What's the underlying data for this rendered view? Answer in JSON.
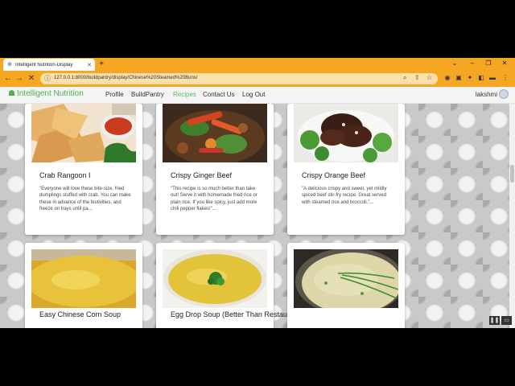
{
  "browser": {
    "tab_title": "Intelligent Nutrition-Display",
    "url": "127.0.0.1:8000/buildpantry/display/Chinese%20Steamed%20Buns/",
    "accent": "#f5a623"
  },
  "site": {
    "brand": "Intelligent Nutrition",
    "nav": [
      "Profile",
      "BuildPantry",
      "Recipes",
      "Contact Us",
      "Log Out"
    ],
    "active_nav": "Recipes",
    "user": "lakshmi",
    "brand_color": "#4caf50"
  },
  "recipes": [
    {
      "title": "Crab Rangoon I",
      "desc": "\"Everyone will love these bite-size, fried dumplings stuffed with crab. You can make these in advance of the festivities, and freeze on trays until pa..."
    },
    {
      "title": "Crispy Ginger Beef",
      "desc": "\"This recipe is so much better than take out! Serve it with homemade fried rice or plain rice. If you like spicy, just add more chili pepper flakes!\"..."
    },
    {
      "title": "Crispy Orange Beef",
      "desc": "\"A delicious crispy and sweet, yet mildly spiced beef stir-fry recipe. Great served with steamed rice and broccoli.\"..."
    },
    {
      "title": "Easy Chinese Corn Soup",
      "desc": ""
    },
    {
      "title": "Egg Drop Soup (Better Than Restaurant Quality!)",
      "desc": ""
    },
    {
      "title": "",
      "desc": ""
    }
  ]
}
